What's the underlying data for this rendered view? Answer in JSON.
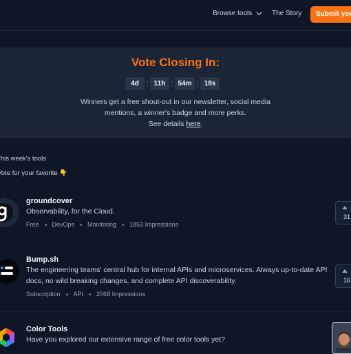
{
  "header": {
    "browse_label": "Browse tools",
    "story_label": "The Story",
    "submit_label": "Submit your tool"
  },
  "banner": {
    "title": "Vote Closing In:",
    "timer": {
      "days": "4d",
      "hours": "11h",
      "minutes": "54m",
      "seconds": "18s"
    },
    "text_line1": "Winners get a free shout-out in our newsletter, social media",
    "text_line2": "mentions, a winner's badge and more perks.",
    "details_prefix": "See details ",
    "details_link": "here",
    "details_suffix": "."
  },
  "section": {
    "title": "This week's tools",
    "subtitle": "Vote for your favorite 👇"
  },
  "tools": [
    {
      "name": "groundcover",
      "description": "Observability, for the Cloud.",
      "tags": [
        "Free",
        "DevOps",
        "Monitoring",
        "1853 Impressions"
      ],
      "votes": "31"
    },
    {
      "name": "Bump.sh",
      "description": "The engineering teams' central hub for internal APIs and microservices. Always up-to-date API docs, no wild breaking changes, and complete API discoverability.",
      "tags": [
        "Subscription",
        "API",
        "2068 Impressions"
      ],
      "votes": "16"
    },
    {
      "name": "Color Tools",
      "description": "Have you explored our extensive range of free color tools yet?",
      "tags": []
    }
  ],
  "colors": {
    "accent": "#f97316",
    "background": "#0f1726",
    "banner": "#1b2536"
  }
}
